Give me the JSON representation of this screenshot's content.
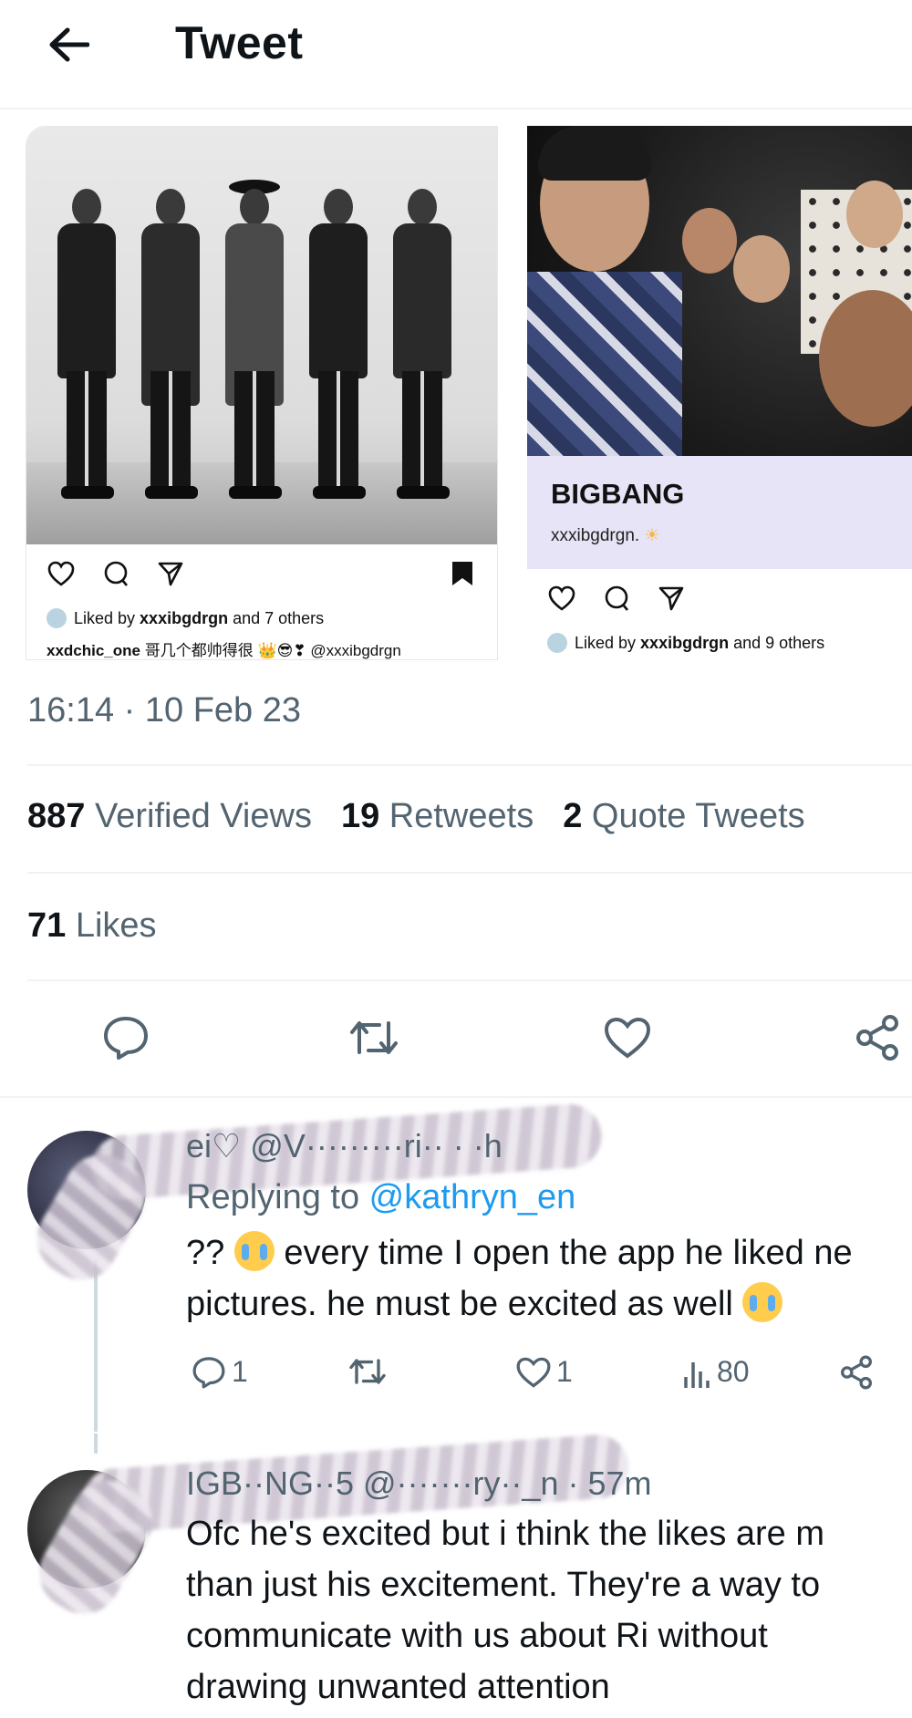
{
  "header": {
    "title": "Tweet"
  },
  "media": {
    "left_card": {
      "liked_by_prefix": "Liked by ",
      "liked_by_user": "xxxibgdrgn",
      "liked_by_suffix": " and 7 others",
      "caption_user": "xxdchic_one",
      "caption_text": "哥几个都帅得很",
      "caption_mention": "@xxxibgdrgn"
    },
    "right_card": {
      "title": "BIGBANG",
      "handle": "xxxibgdrgn.",
      "liked_by_prefix": "Liked by ",
      "liked_by_user": "xxxibgdrgn",
      "liked_by_suffix": " and 9 others"
    }
  },
  "tweet": {
    "timestamp": "16:14 · 10 Feb 23",
    "views_count": "887",
    "views_label": "Verified Views",
    "retweets_count": "19",
    "retweets_label": "Retweets",
    "quotes_count": "2",
    "quotes_label": "Quote Tweets",
    "likes_count": "71",
    "likes_label": "Likes"
  },
  "replies": [
    {
      "meta": "ei♡ @V·········ri·· · ·h",
      "replying_prefix": "Replying to ",
      "replying_mention": "@kathryn_en",
      "line1_a": "??",
      "line1_b": "every time I open the app he liked ne",
      "line2": "pictures. he must be excited as well",
      "reply_count": "1",
      "like_count": "1",
      "view_count": "80"
    },
    {
      "meta": "IGB··NG··5 @·······ry··_n · 57m",
      "line1": "Ofc he's excited but i think the likes are m",
      "line2": "than just his excitement. They're a way to",
      "line3": "communicate with us about Ri without",
      "line4": "drawing unwanted attention"
    }
  ],
  "icons": {
    "back": "arrow-left-icon",
    "reply": "speech-bubble-icon",
    "retweet": "retweet-icon",
    "like": "heart-icon",
    "share": "share-icon",
    "views": "bar-chart-icon"
  },
  "colors": {
    "text_primary": "#0f1419",
    "text_secondary": "#536471",
    "link": "#1d9bf0",
    "divider": "#eff3f4"
  }
}
